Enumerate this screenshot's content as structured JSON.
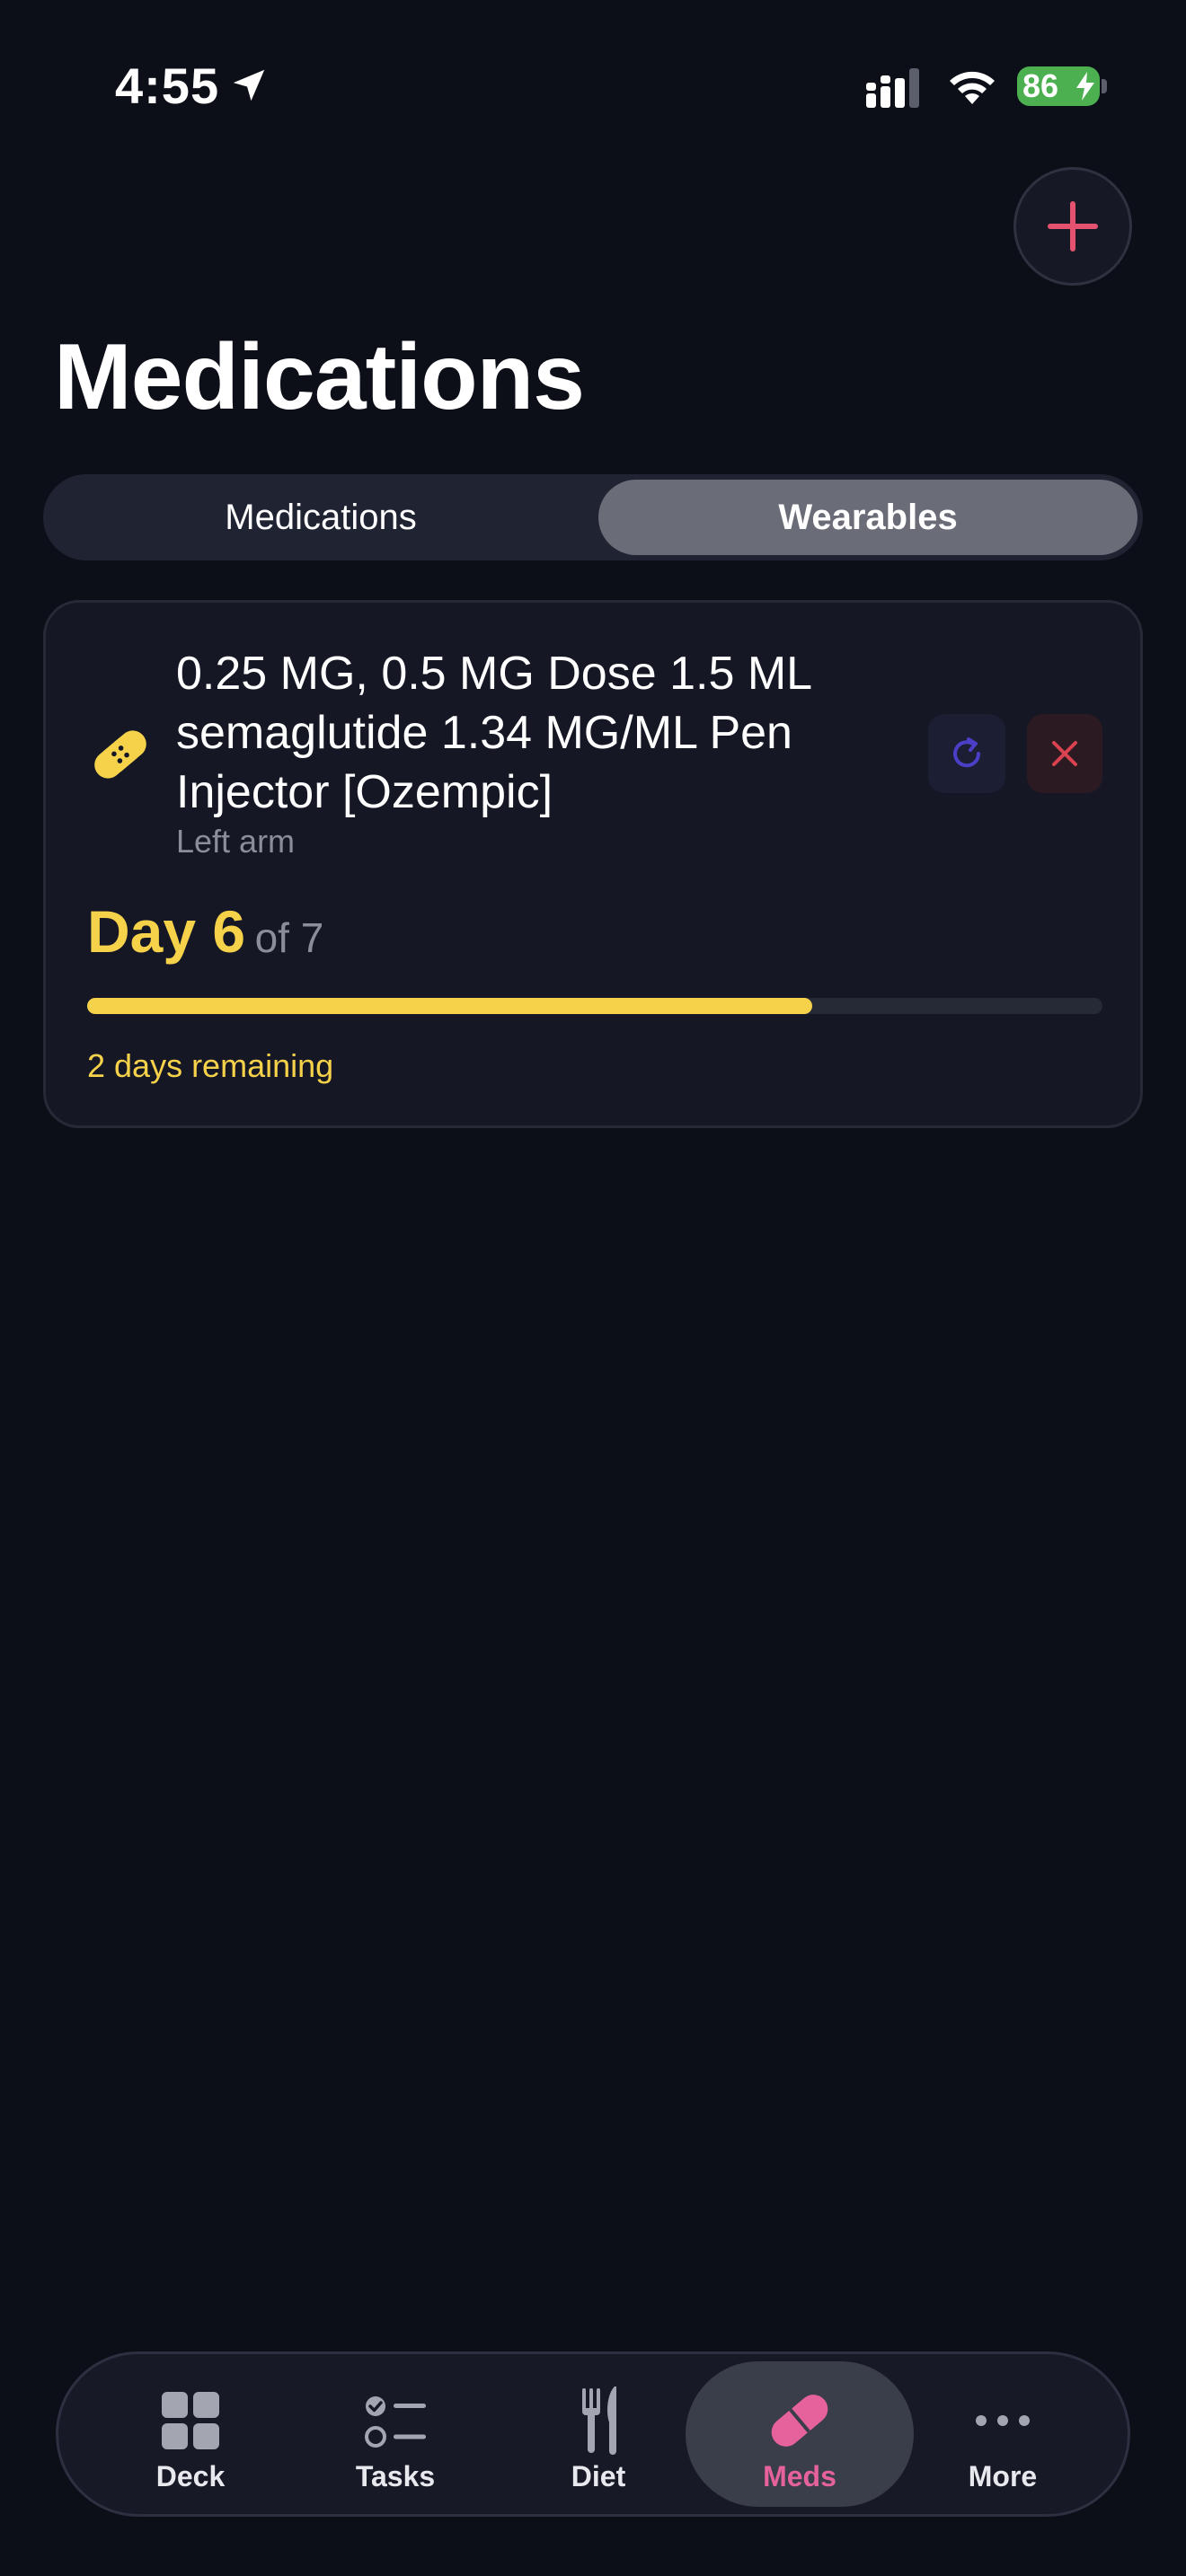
{
  "status_bar": {
    "time": "4:55",
    "battery": "86",
    "icons": [
      "location-arrow-icon",
      "cellular-signal-icon",
      "wifi-icon",
      "battery-charging-icon"
    ]
  },
  "header": {
    "title": "Medications",
    "add_icon": "plus-icon"
  },
  "segmented": {
    "tabs": [
      {
        "label": "Medications",
        "selected": false
      },
      {
        "label": "Wearables",
        "selected": true
      }
    ]
  },
  "wearable_card": {
    "icon": "bandage-icon",
    "name": "0.25 MG, 0.5 MG Dose 1.5 ML semaglutide 1.34 MG/ML Pen Injector [Ozempic]",
    "site": "Left arm",
    "day_label": "Day 6",
    "day_total_label": "of 7",
    "progress_fraction": 0.714,
    "remaining": "2 days remaining",
    "actions": [
      "replace-icon",
      "close-icon"
    ]
  },
  "tab_bar": {
    "items": [
      {
        "label": "Deck",
        "icon": "grid-icon",
        "active": false
      },
      {
        "label": "Tasks",
        "icon": "checklist-icon",
        "active": false
      },
      {
        "label": "Diet",
        "icon": "fork-knife-icon",
        "active": false
      },
      {
        "label": "Meds",
        "icon": "pill-icon",
        "active": true
      },
      {
        "label": "More",
        "icon": "more-dots-icon",
        "active": false
      }
    ]
  },
  "colors": {
    "background": "#0c0e18",
    "accent_yellow": "#f6d24b",
    "accent_pink": "#e5629c",
    "remove_red": "#d9434f",
    "replace_purple": "#4b3fc7"
  }
}
